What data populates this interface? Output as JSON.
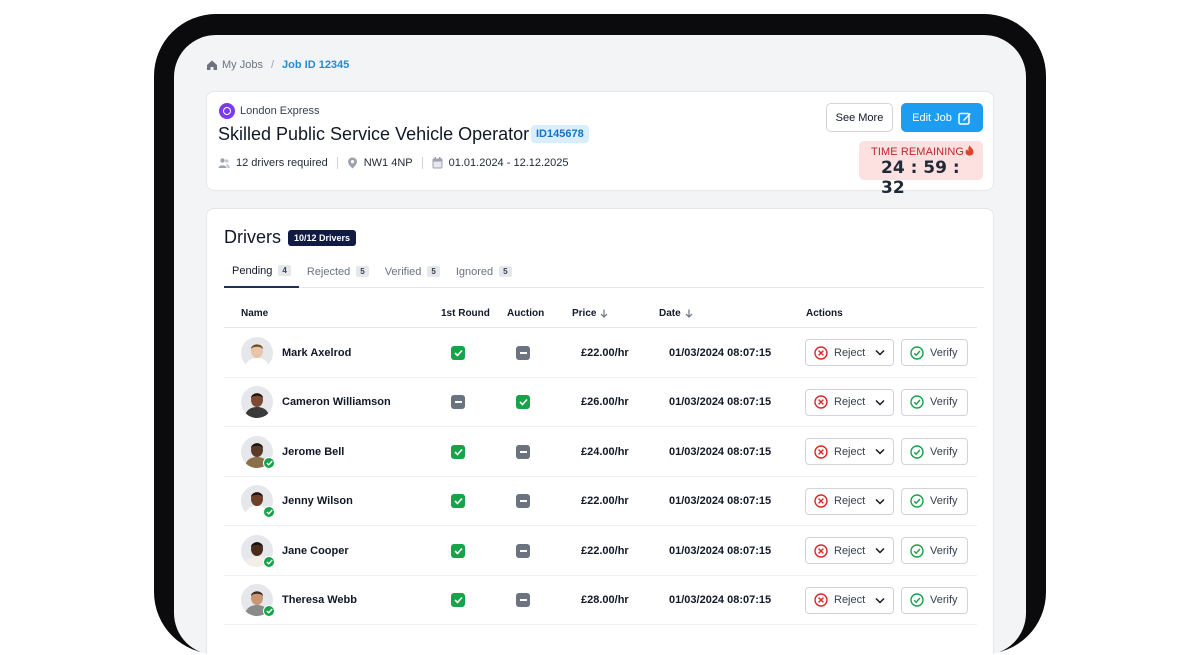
{
  "breadcrumb": {
    "root": "My Jobs",
    "separator": "/",
    "current": "Job ID 12345"
  },
  "job": {
    "company": "London Express",
    "title": "Skilled Public Service Vehicle Operator",
    "id_badge": "ID145678",
    "drivers_required": "12 drivers required",
    "location": "NW1 4NP",
    "dates": "01.01.2024 - 12.12.2025",
    "see_more_label": "See More",
    "edit_label": "Edit Job",
    "timer_label": "TIME REMAINING",
    "timer_value": "24 : 59 : 32"
  },
  "drivers": {
    "title": "Drivers",
    "badge": "10/12 Drivers",
    "tabs": [
      {
        "label": "Pending",
        "count": "4"
      },
      {
        "label": "Rejected",
        "count": "5"
      },
      {
        "label": "Verified",
        "count": "5"
      },
      {
        "label": "Ignored",
        "count": "5"
      }
    ],
    "columns": {
      "name": "Name",
      "first_round": "1st Round",
      "auction": "Auction",
      "price": "Price",
      "date": "Date",
      "actions": "Actions"
    },
    "reject_label": "Reject",
    "verify_label": "Verify",
    "rows": [
      {
        "name": "Mark Axelrod",
        "first_round": true,
        "auction": false,
        "price": "£22.00/hr",
        "date": "01/03/2024 08:07:15",
        "verified": false
      },
      {
        "name": "Cameron Williamson",
        "first_round": false,
        "auction": true,
        "price": "£26.00/hr",
        "date": "01/03/2024 08:07:15",
        "verified": false
      },
      {
        "name": "Jerome Bell",
        "first_round": true,
        "auction": false,
        "price": "£24.00/hr",
        "date": "01/03/2024 08:07:15",
        "verified": true
      },
      {
        "name": "Jenny Wilson",
        "first_round": true,
        "auction": false,
        "price": "£22.00/hr",
        "date": "01/03/2024 08:07:15",
        "verified": true
      },
      {
        "name": "Jane Cooper",
        "first_round": true,
        "auction": false,
        "price": "£22.00/hr",
        "date": "01/03/2024 08:07:15",
        "verified": true
      },
      {
        "name": "Theresa Webb",
        "first_round": true,
        "auction": false,
        "price": "£28.00/hr",
        "date": "01/03/2024 08:07:15",
        "verified": true
      }
    ]
  },
  "colors": {
    "accent": "#1c9df2",
    "link": "#1f8bd6",
    "badge_dark": "#101a43",
    "success": "#16a34a",
    "danger": "#dc2626",
    "timer_bg": "#fde0e0"
  }
}
